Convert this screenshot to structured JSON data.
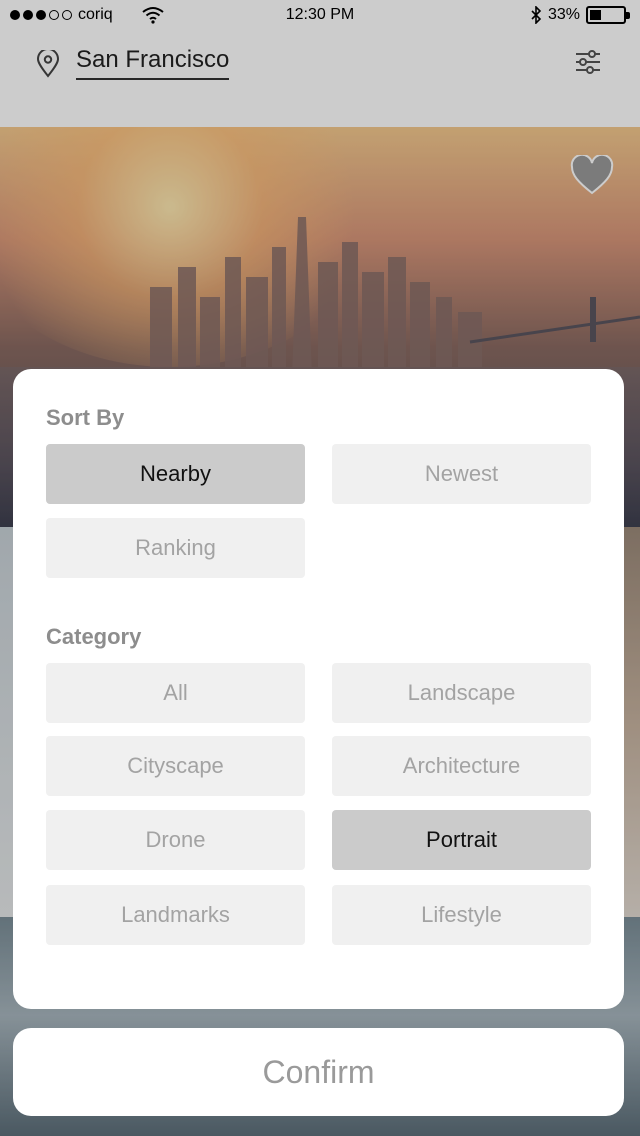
{
  "status_bar": {
    "carrier": "coriq",
    "signal_bars_filled": 3,
    "signal_bars_total": 5,
    "time": "12:30 PM",
    "battery": "33%",
    "battery_level": 0.33,
    "icons": [
      "wifi-icon",
      "bluetooth-icon",
      "battery-icon"
    ]
  },
  "header": {
    "location": "San Francisco",
    "location_icon": "map-pin-icon",
    "filter_icon": "sliders-icon"
  },
  "hero": {
    "favorite_icon": "heart-icon"
  },
  "filter_sheet": {
    "sort": {
      "title": "Sort By",
      "options": [
        {
          "label": "Nearby",
          "selected": true
        },
        {
          "label": "Newest",
          "selected": false
        },
        {
          "label": "Ranking",
          "selected": false
        }
      ]
    },
    "category": {
      "title": "Category",
      "options": [
        {
          "label": "All",
          "selected": false
        },
        {
          "label": "Landscape",
          "selected": false
        },
        {
          "label": "Cityscape",
          "selected": false
        },
        {
          "label": "Architecture",
          "selected": false
        },
        {
          "label": "Drone",
          "selected": false
        },
        {
          "label": "Portrait",
          "selected": true
        },
        {
          "label": "Landmarks",
          "selected": false
        },
        {
          "label": "Lifestyle",
          "selected": false
        }
      ]
    }
  },
  "confirm_label": "Confirm",
  "colors": {
    "chip_default": "#f0f0f0",
    "chip_selected": "#cbcbcb",
    "section_title": "#8d8d8d"
  }
}
